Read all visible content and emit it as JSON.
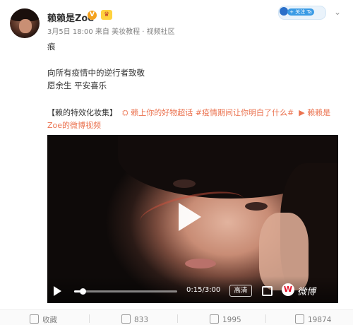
{
  "user": {
    "name": "赖赖是Zoe",
    "verified_badge": "V",
    "member_badge": "♛",
    "follow_badge_text": "+ 关注 Ta"
  },
  "meta": {
    "date": "3月5日 18:00",
    "source": "来自 美妆教程 · 视频社区"
  },
  "post": {
    "line1": "痕",
    "line2": "向所有疫情中的逆行者致敬",
    "line3": "愿余生 平安喜乐"
  },
  "tagline": {
    "prefix": "【赖的特效化妆集】",
    "topic": "赖上你的好物超话",
    "hashtag": "#疫情期间让你明白了什么#",
    "link": "赖赖是Zoe的微博视频"
  },
  "video": {
    "current_time": "0:15",
    "duration": "3:00",
    "time_text": "0:15/3:00",
    "progress": 0.083,
    "quality": "高清",
    "brand": "微博"
  },
  "actions": {
    "collect": "收藏",
    "repost": "833",
    "comment": "1995",
    "like": "19874"
  },
  "colors": {
    "link": "#eb7350",
    "weibo_red": "#e6162d",
    "badge_orange": "#f4a21e"
  }
}
